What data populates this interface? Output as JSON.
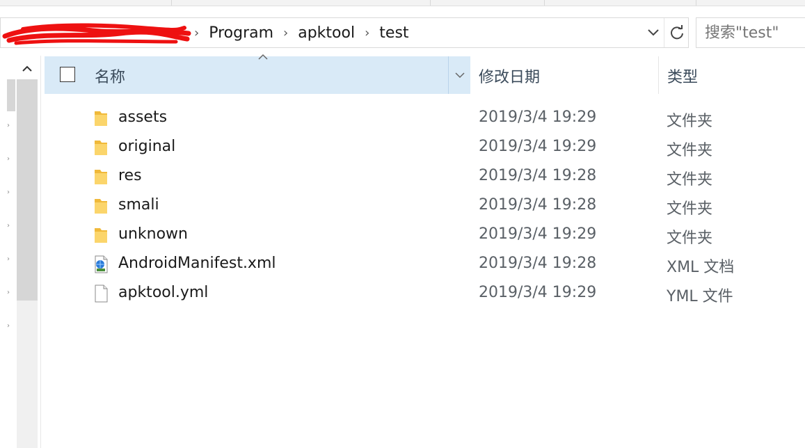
{
  "address_bar": {
    "breadcrumbs": [
      "Program",
      "apktool",
      "test"
    ]
  },
  "search": {
    "placeholder": "搜索\"test\""
  },
  "columns": {
    "name": "名称",
    "date_modified": "修改日期",
    "type": "类型"
  },
  "files": [
    {
      "name": "assets",
      "date": "2019/3/4 19:29",
      "type": "文件夹",
      "icon": "folder-icon"
    },
    {
      "name": "original",
      "date": "2019/3/4 19:29",
      "type": "文件夹",
      "icon": "folder-icon"
    },
    {
      "name": "res",
      "date": "2019/3/4 19:28",
      "type": "文件夹",
      "icon": "folder-icon"
    },
    {
      "name": "smali",
      "date": "2019/3/4 19:28",
      "type": "文件夹",
      "icon": "folder-icon"
    },
    {
      "name": "unknown",
      "date": "2019/3/4 19:29",
      "type": "文件夹",
      "icon": "folder-icon"
    },
    {
      "name": "AndroidManifest.xml",
      "date": "2019/3/4 19:28",
      "type": "XML 文档",
      "icon": "xml-document-icon"
    },
    {
      "name": "apktool.yml",
      "date": "2019/3/4 19:29",
      "type": "YML 文件",
      "icon": "blank-file-icon"
    }
  ],
  "colors": {
    "header_selected": "#d9eaf7",
    "folder_yellow": "#f5c542",
    "redaction": "#ee1111"
  }
}
